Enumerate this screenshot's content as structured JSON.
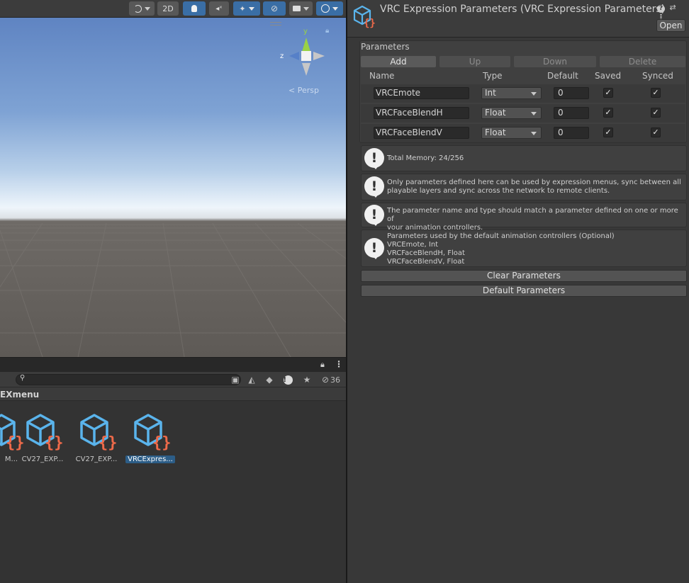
{
  "scene": {
    "toolbar": {
      "mode_2d_label": "2D"
    },
    "gizmo": {
      "y_axis_label": "y",
      "z_axis_label": "z",
      "projection_label": "Persp"
    }
  },
  "project": {
    "hidden_count": "36",
    "breadcrumb": "EXmenu",
    "assets": [
      {
        "label": "M..."
      },
      {
        "label": "CV27_EXP..."
      },
      {
        "label": "CV27_EXP..."
      },
      {
        "label": "VRCExpres..."
      }
    ]
  },
  "inspector": {
    "title": "VRC Expression Parameters (VRC Expression Parameters)",
    "open_label": "Open",
    "section_label": "Parameters",
    "buttons": {
      "add": "Add",
      "up": "Up",
      "down": "Down",
      "delete": "Delete"
    },
    "columns": {
      "name": "Name",
      "type": "Type",
      "default": "Default",
      "saved": "Saved",
      "synced": "Synced"
    },
    "parameters": [
      {
        "name": "VRCEmote",
        "type": "Int",
        "default": "0",
        "saved": true,
        "synced": true
      },
      {
        "name": "VRCFaceBlendH",
        "type": "Float",
        "default": "0",
        "saved": true,
        "synced": true
      },
      {
        "name": "VRCFaceBlendV",
        "type": "Float",
        "default": "0",
        "saved": true,
        "synced": true
      }
    ],
    "help": {
      "memory": "Total Memory: 24/256",
      "defined_1": "Only parameters defined here can be used by expression menus, sync between all",
      "defined_2": "playable layers and sync across the network to remote clients.",
      "match_1": "The parameter name and type should match a parameter defined on one or more of",
      "match_2": "your animation controllers.",
      "defaults_1": "Parameters used by the default animation controllers (Optional)",
      "defaults_2": "VRCEmote, Int",
      "defaults_3": "VRCFaceBlendH, Float",
      "defaults_4": "VRCFaceBlendV, Float"
    },
    "clear_label": "Clear Parameters",
    "default_label": "Default Parameters"
  },
  "colors": {
    "selection": "#2c5d87",
    "toolbar_active": "#3a6ea5",
    "asset_cube": "#5ab4ec",
    "asset_braces": "#ef6a4a"
  }
}
